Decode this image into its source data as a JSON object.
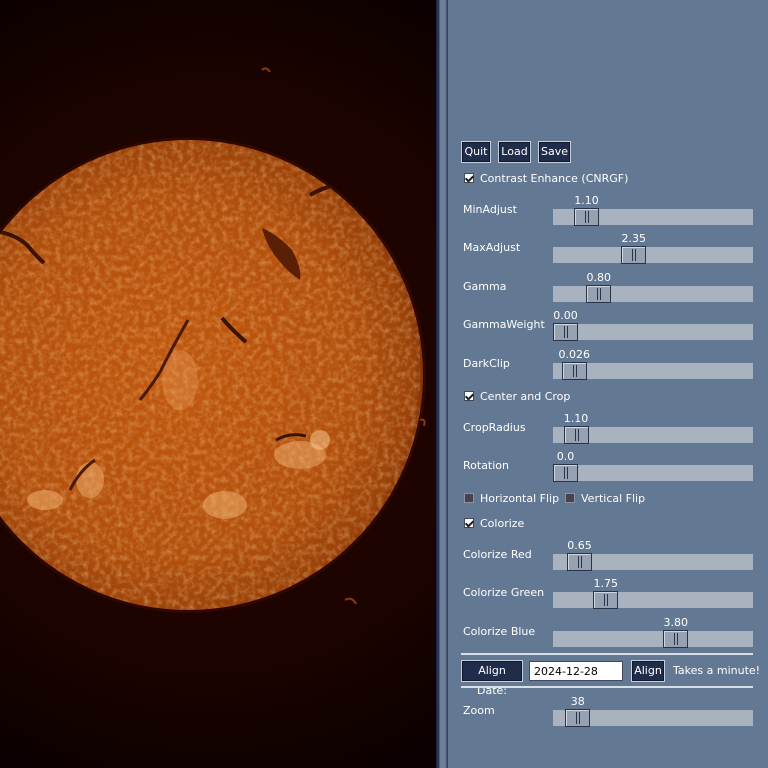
{
  "buttons": {
    "quit": "Quit",
    "load": "Load",
    "save": "Save"
  },
  "checkboxes": {
    "contrast": {
      "label": "Contrast Enhance (CNRGF)",
      "checked": true
    },
    "center_crop": {
      "label": "Center and Crop",
      "checked": true
    },
    "hflip": {
      "label": "Horizontal Flip",
      "checked": false
    },
    "vflip": {
      "label": "Vertical Flip",
      "checked": false
    },
    "colorize": {
      "label": "Colorize",
      "checked": true
    }
  },
  "sliders": {
    "min_adjust": {
      "label": "MinAdjust",
      "value": "1.10",
      "fraction": 0.12
    },
    "max_adjust": {
      "label": "MaxAdjust",
      "value": "2.35",
      "fraction": 0.39
    },
    "gamma": {
      "label": "Gamma",
      "value": "0.80",
      "fraction": 0.19
    },
    "gamma_weight": {
      "label": "GammaWeight",
      "value": "0.00",
      "fraction": 0.0
    },
    "dark_clip": {
      "label": "DarkClip",
      "value": "0.026",
      "fraction": 0.05
    },
    "crop_radius": {
      "label": "CropRadius",
      "value": "1.10",
      "fraction": 0.06
    },
    "rotation": {
      "label": "Rotation",
      "value": "0.0",
      "fraction": 0.0
    },
    "colorize_red": {
      "label": "Colorize Red",
      "value": "0.65",
      "fraction": 0.08
    },
    "colorize_green": {
      "label": "Colorize Green",
      "value": "1.75",
      "fraction": 0.23
    },
    "colorize_blue": {
      "label": "Colorize Blue",
      "value": "3.80",
      "fraction": 0.63
    },
    "zoom": {
      "label": "Zoom",
      "value": "38",
      "fraction": 0.07
    }
  },
  "align": {
    "button_label": "Align Date:",
    "date_value": "2024-12-28",
    "align_button": "Align",
    "note": "Takes a minute!"
  },
  "colors": {
    "panel": "#637892",
    "button": "#1f2c4a",
    "track": "#a9b3c0",
    "sun_core": "#c25a10",
    "sun_edge": "#7a2d05"
  }
}
